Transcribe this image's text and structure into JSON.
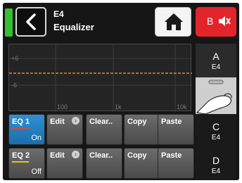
{
  "header": {
    "title_main": "E4",
    "title_sub": "Equalizer",
    "mute_channel": "B",
    "status_color": "#33c033",
    "mute_color": "#e3242b"
  },
  "graph": {
    "y_ticks": [
      "+6",
      "-6"
    ],
    "x_ticks": [
      "100",
      "1k",
      "10k"
    ],
    "curve_color": "#e08a1e"
  },
  "equalizers": [
    {
      "label": "EQ 1",
      "state": "On",
      "underline_color": "#e0472a",
      "active": true
    },
    {
      "label": "EQ 2",
      "state": "Off",
      "underline_color": "#e6c21d",
      "active": false
    }
  ],
  "row_actions": {
    "edit": "Edit",
    "clear": "Clear..",
    "copy": "Copy",
    "paste": "Paste"
  },
  "side_tabs": [
    {
      "letter": "A",
      "name": "E4"
    },
    {
      "letter": "C",
      "name": "E4"
    },
    {
      "letter": "D",
      "name": "E4"
    }
  ],
  "icons": [
    "back-chevron-icon",
    "home-icon",
    "speaker-muted-icon",
    "chevron-right-icon",
    "hand-pointer-icon"
  ]
}
